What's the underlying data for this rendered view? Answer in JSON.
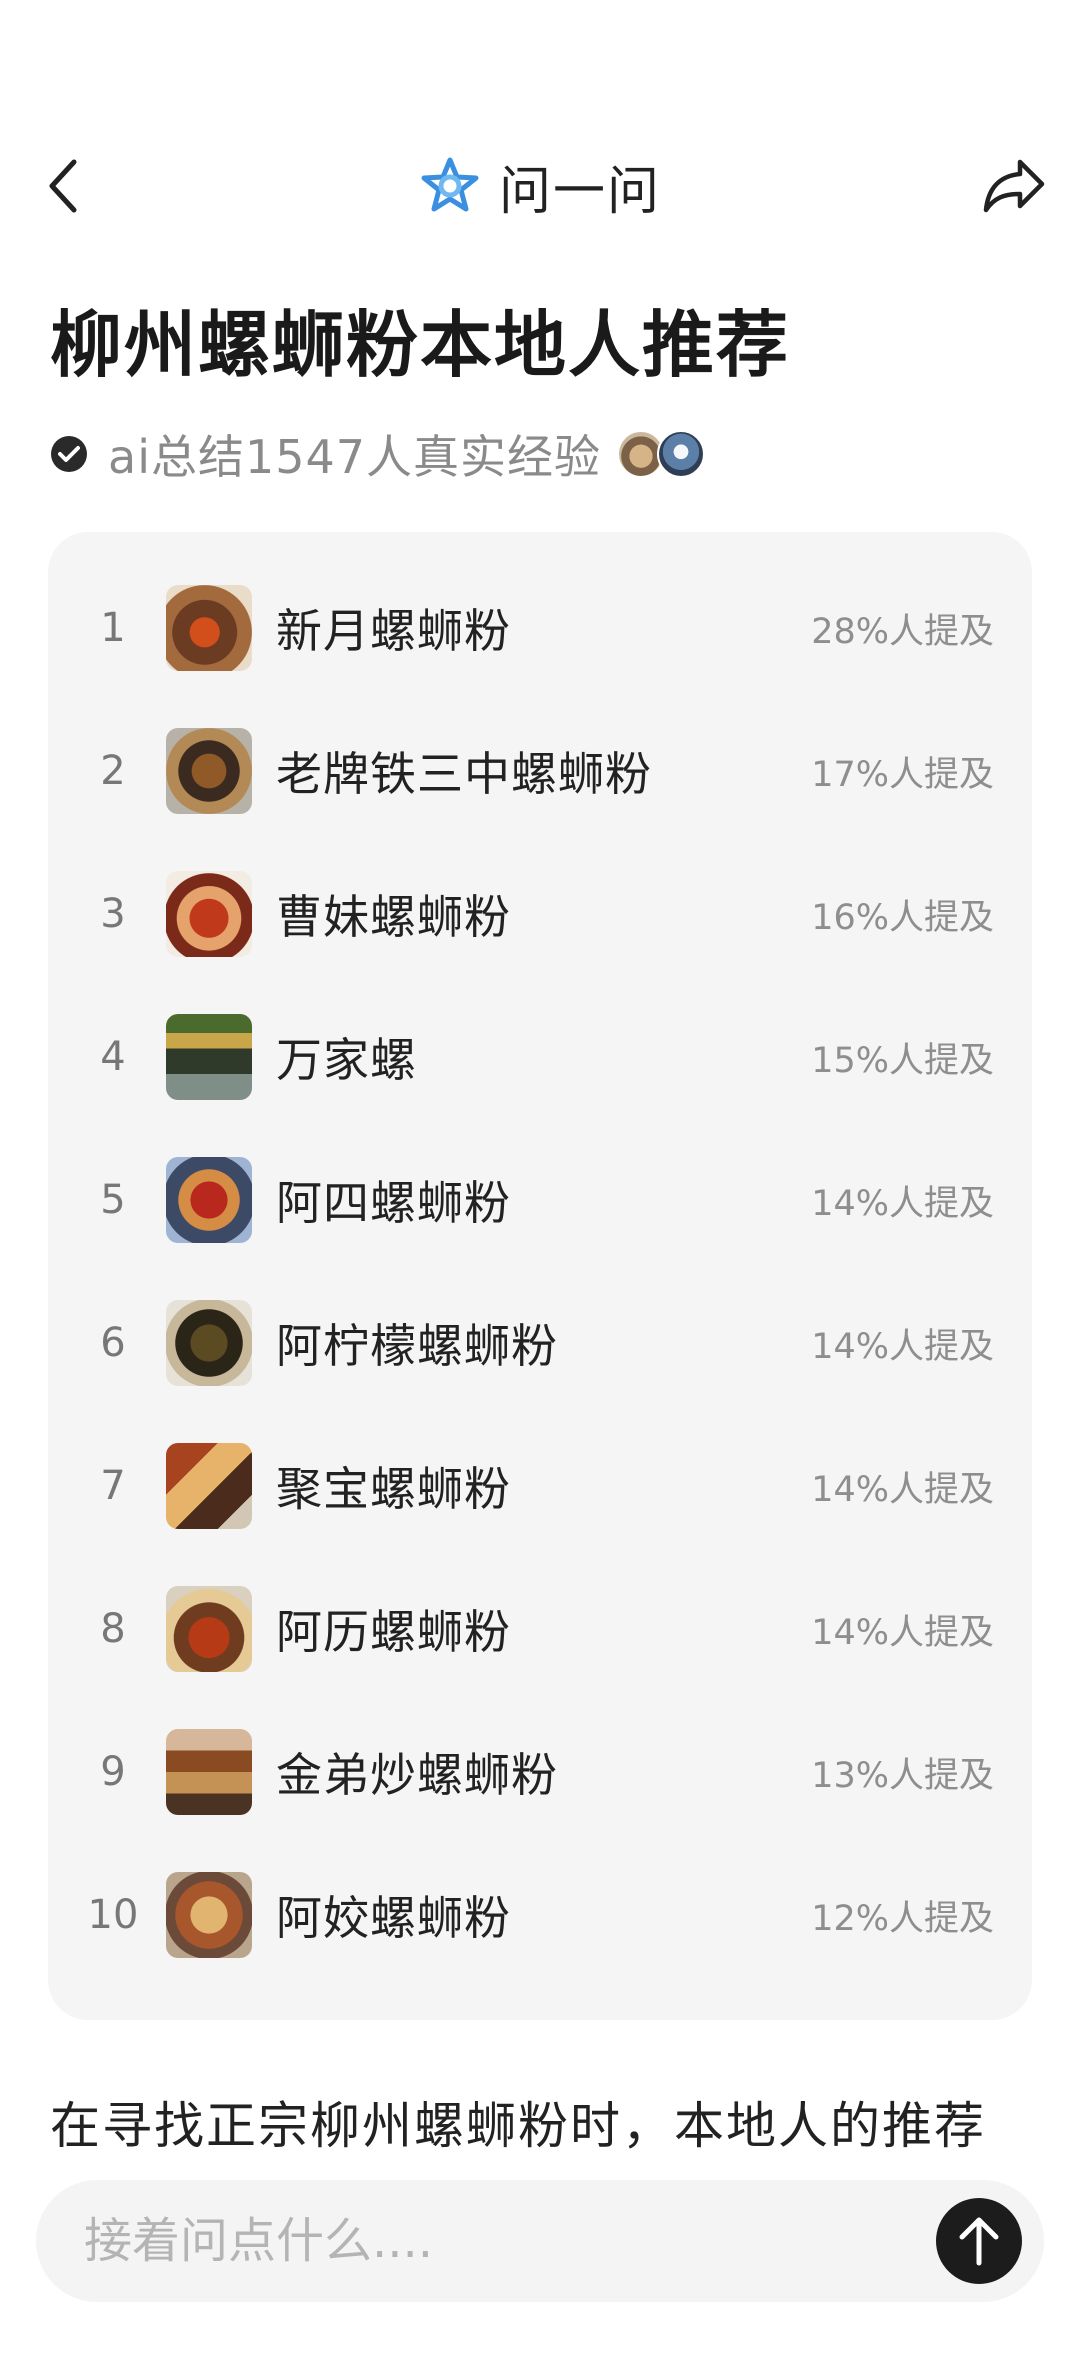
{
  "header": {
    "title": "问一问",
    "back_icon": "chevron-left-icon",
    "share_icon": "share-icon",
    "logo_icon": "star-logo-icon",
    "accent_color": "#3a8fe0"
  },
  "page_title": "柳州螺蛳粉本地人推荐",
  "summary": {
    "text": "ai总结1547人真实经验",
    "icon": "check-circle-icon"
  },
  "ranking": [
    {
      "rank": "1",
      "name": "新月螺蛳粉",
      "mention": "28%人提及"
    },
    {
      "rank": "2",
      "name": "老牌铁三中螺蛳粉",
      "mention": "17%人提及"
    },
    {
      "rank": "3",
      "name": "曹妹螺蛳粉",
      "mention": "16%人提及"
    },
    {
      "rank": "4",
      "name": "万家螺",
      "mention": "15%人提及"
    },
    {
      "rank": "5",
      "name": "阿四螺蛳粉",
      "mention": "14%人提及"
    },
    {
      "rank": "6",
      "name": "阿柠檬螺蛳粉",
      "mention": "14%人提及"
    },
    {
      "rank": "7",
      "name": "聚宝螺蛳粉",
      "mention": "14%人提及"
    },
    {
      "rank": "8",
      "name": "阿历螺蛳粉",
      "mention": "14%人提及"
    },
    {
      "rank": "9",
      "name": "金弟炒螺蛳粉",
      "mention": "13%人提及"
    },
    {
      "rank": "10",
      "name": "阿姣螺蛳粉",
      "mention": "12%人提及"
    }
  ],
  "paragraph": "在寻找正宗柳州螺蛳粉时，本地人的推荐",
  "input": {
    "placeholder": "接着问点什么....",
    "send_icon": "arrow-up-icon"
  }
}
